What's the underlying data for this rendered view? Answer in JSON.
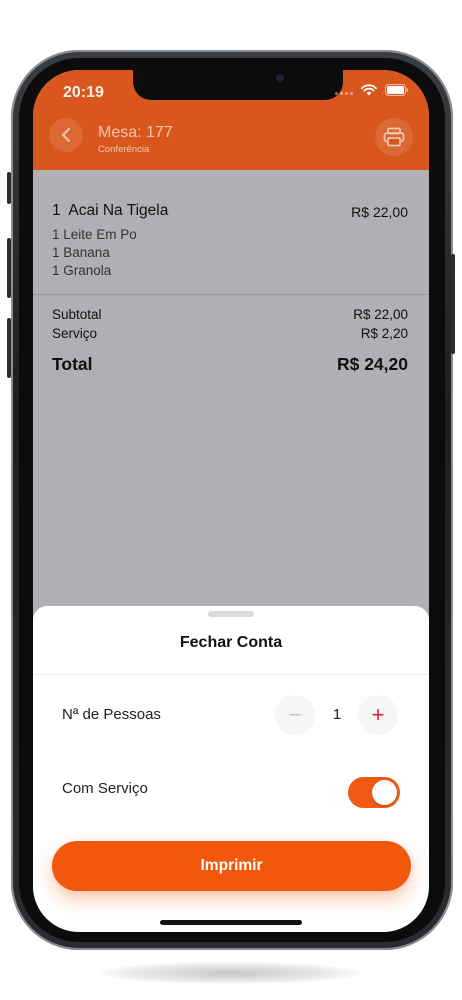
{
  "status_bar": {
    "time": "20:19"
  },
  "header": {
    "title": "Mesa: 177",
    "subtitle": "Conferência"
  },
  "order": {
    "item": {
      "qty": "1",
      "name": "Acai Na Tigela",
      "price": "R$ 22,00"
    },
    "sub_items": [
      {
        "qty": "1",
        "name": "Leite Em Po"
      },
      {
        "qty": "1",
        "name": "Banana"
      },
      {
        "qty": "1",
        "name": "Granola"
      }
    ],
    "subtotal_label": "Subtotal",
    "subtotal_value": "R$ 22,00",
    "service_label": "Serviço",
    "service_value": "R$ 2,20",
    "total_label": "Total",
    "total_value": "R$ 24,20"
  },
  "sheet": {
    "title": "Fechar Conta",
    "people_label": "Nª de Pessoas",
    "people_minus": "−",
    "people_count": "1",
    "people_plus": "+",
    "service_toggle_label": "Com Serviço",
    "service_toggle_on": true,
    "print_button": "Imprimir"
  },
  "colors": {
    "accent": "#f2580c",
    "header": "#d9571e",
    "plus": "#e0222a"
  }
}
